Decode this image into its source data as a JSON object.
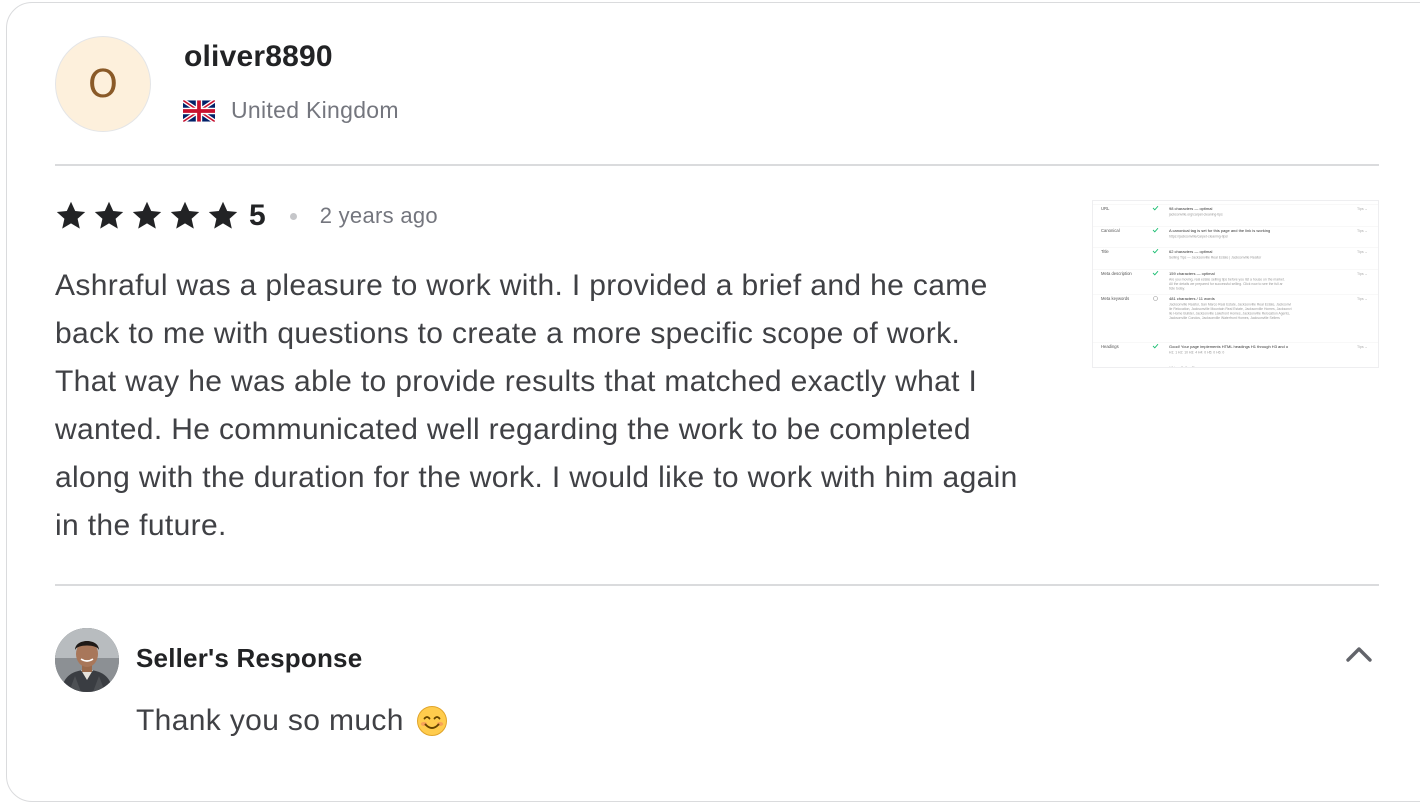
{
  "reviewer": {
    "initial": "O",
    "username": "oliver8890",
    "country": "United Kingdom",
    "flag_icon": "uk-flag-icon"
  },
  "review": {
    "star_count": 5,
    "rating": "5",
    "time_ago": "2 years ago",
    "text": "Ashraful was a pleasure to work with. I provided a brief and he came back to me with questions to create a more specific scope of work. That way he was able to provide results that matched exactly what I wanted. He communicated well regarding the work to be completed along with the duration for the work. I would like to work with him again in the future.",
    "attachment": {
      "rows": [
        {
          "label": "URL",
          "status": "check",
          "headline": "98 characters — optimal",
          "detail": "jacksonville.org/carpet-cleaning-tips",
          "tag": "Tips"
        },
        {
          "label": "Canonical",
          "status": "check",
          "headline": "A canonical tag is set for this page and the link is working fine.",
          "detail": "https://jacksonville/carpet-cleaning-tips/",
          "tag": "Tips"
        },
        {
          "label": "Title",
          "status": "check",
          "headline": "62 characters — optimal",
          "detail": "Selling Tips — Jacksonville Real Estate | Jacksonville Realtor",
          "tag": "Tips"
        },
        {
          "label": "Meta description",
          "status": "check",
          "headline": "159 characters — optimal",
          "detail": "Are you moving, real estate selling tips before you list a house on the market. All the details we prepared for successful selling. Click now to see the full article today.",
          "tag": "Tips"
        },
        {
          "label": "Meta keywords",
          "status": "info",
          "headline": "481 characters / 11 words",
          "detail": "Jacksonville Realtor, San Marco Real Estate, Jacksonville Real Estate, Jacksonville Relocation, Jacksonville Mountain Real Estate, Jacksonville Homes, Jacksonville Home Builder, Jacksonville Lakefront Homes, Jacksonville Relocation Agents, Jacksonville Condos, Jacksonville Waterfront Homes, Jacksonville Sellers",
          "tag": "Tips"
        },
        {
          "label": "Headings",
          "status": "check",
          "headline": "Good! Your page implements HTML headings H1 through H3 and only one H1 heading is used.",
          "detail": "H1: 1  H2: 10  H3: 4  H4: 0  H5: 0  H6: 0",
          "tag": "Tips"
        }
      ],
      "footer": "H1 tag: Selling Tips"
    }
  },
  "seller_response": {
    "avatar_icon": "seller-avatar",
    "title": "Seller's Response",
    "text": "Thank you so much",
    "emoji_icon": "smiling-face-emoji",
    "toggle_icon": "chevron-up-icon"
  },
  "colors": {
    "star": "#222325",
    "heading": "#222325",
    "body": "#404145",
    "muted": "#74767e",
    "divider": "#dadbdd",
    "avatar_bg": "#fdf0dc",
    "avatar_letter": "#8a5a28",
    "thumb_check": "#1dbf73"
  }
}
